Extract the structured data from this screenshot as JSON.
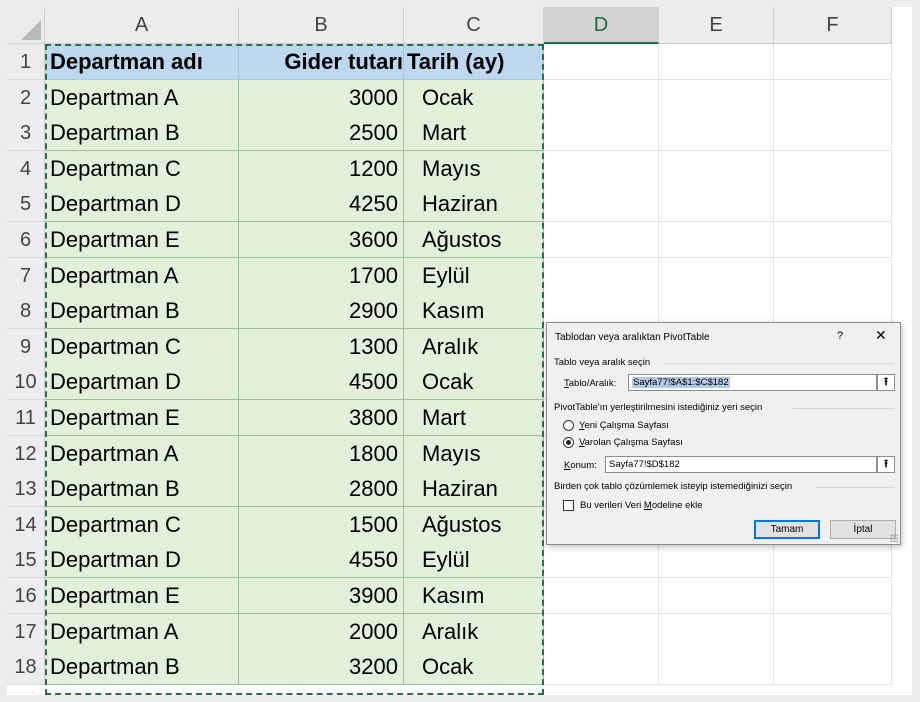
{
  "columns": [
    "A",
    "B",
    "C",
    "D",
    "E",
    "F"
  ],
  "rows": [
    "1",
    "2",
    "3",
    "4",
    "5",
    "6",
    "7",
    "8",
    "9",
    "10",
    "11",
    "12",
    "13",
    "14",
    "15",
    "16",
    "17",
    "18"
  ],
  "table": {
    "headers": [
      "Departman adı",
      "Gider tutarı",
      "Tarih (ay)"
    ],
    "data": [
      [
        "Departman A",
        "3000",
        "Ocak"
      ],
      [
        "Departman B",
        "2500",
        "Mart"
      ],
      [
        "Departman C",
        "1200",
        "Mayıs"
      ],
      [
        "Departman D",
        "4250",
        "Haziran"
      ],
      [
        "Departman E",
        "3600",
        "Ağustos"
      ],
      [
        "Departman A",
        "1700",
        "Eylül"
      ],
      [
        "Departman B",
        "2900",
        "Kasım"
      ],
      [
        "Departman C",
        "1300",
        "Aralık"
      ],
      [
        "Departman D",
        "4500",
        "Ocak"
      ],
      [
        "Departman E",
        "3800",
        "Mart"
      ],
      [
        "Departman A",
        "1800",
        "Mayıs"
      ],
      [
        "Departman B",
        "2800",
        "Haziran"
      ],
      [
        "Departman C",
        "1500",
        "Ağustos"
      ],
      [
        "Departman D",
        "4550",
        "Eylül"
      ],
      [
        "Departman E",
        "3900",
        "Kasım"
      ],
      [
        "Departman A",
        "2000",
        "Aralık"
      ],
      [
        "Departman B",
        "3200",
        "Ocak"
      ]
    ]
  },
  "dialog": {
    "title": "Tablodan veya aralıktan PivotTable",
    "help": "?",
    "close": "✕",
    "section_source": "Tablo veya aralık seçin",
    "range_label_u": "T",
    "range_label_rest": "ablo/Aralık:",
    "range_value": "Sayfa77!$A$1:$C$182",
    "section_location": "PivotTable'ın yerleştirilmesini istediğiniz yeri seçin",
    "new_sheet_u": "Y",
    "new_sheet_rest": "eni Çalışma Sayfası",
    "existing_sheet_u": "V",
    "existing_sheet_rest": "arolan Çalışma Sayfası",
    "location_label_u": "K",
    "location_label_rest": "onum:",
    "location_value": "Sayfa77!$D$182",
    "section_model": "Birden çok tablo çözümlemek isteyip istemediğinizi seçin",
    "model_check_pre": "Bu verileri Veri ",
    "model_check_u": "M",
    "model_check_rest": "odeline ekle",
    "ok": "Tamam",
    "cancel": "İptal",
    "upload_glyph": "⭱"
  },
  "colors": {
    "header_fill": "#bdd7ee",
    "data_fill": "#e2efda",
    "selection_green": "#217346"
  }
}
